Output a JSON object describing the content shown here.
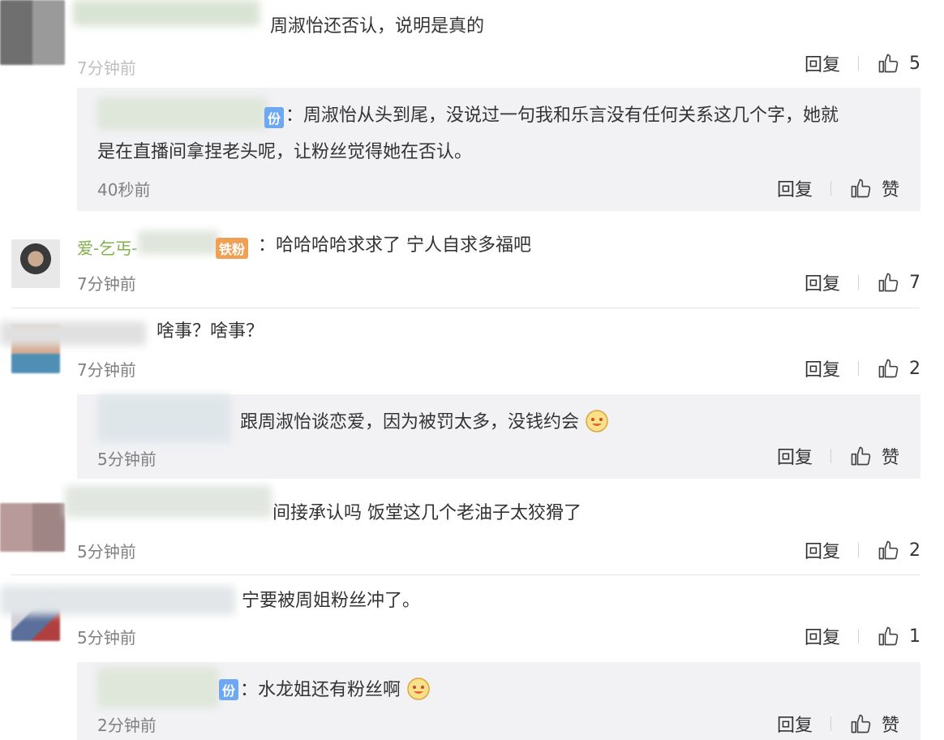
{
  "comments": [
    {
      "text": "周淑怡还否认，说明是真的",
      "time": "7分钟前",
      "reply": "回复",
      "likes": "5"
    },
    {
      "prefix": "：",
      "badge": "份",
      "text": "周淑怡从头到尾，没说过一句我和乐言没有任何关系这几个字，她就",
      "text2": "是在直播间拿捏老头呢，让粉丝觉得她在否认。",
      "time": "40秒前",
      "reply": "回复",
      "likes": "赞"
    },
    {
      "user": "爱-乞丐-",
      "badge": "铁粉",
      "prefix": "：",
      "text": "哈哈哈哈求求了 宁人自求多福吧",
      "time": "7分钟前",
      "reply": "回复",
      "likes": "7"
    },
    {
      "text": "啥事？啥事？",
      "time": "7分钟前",
      "reply": "回复",
      "likes": "2"
    },
    {
      "text": "跟周淑怡谈恋爱，因为被罚太多，没钱约会",
      "time": "5分钟前",
      "reply": "回复",
      "likes": "赞"
    },
    {
      "text": "间接承认吗 饭堂这几个老油子太狡猾了",
      "time": "5分钟前",
      "reply": "回复",
      "likes": "2"
    },
    {
      "text": "宁要被周姐粉丝冲了。",
      "time": "5分钟前",
      "reply": "回复",
      "likes": "1"
    },
    {
      "prefix": "：",
      "badge": "份",
      "text": "水龙姐还有粉丝啊",
      "time": "2分钟前",
      "reply": "回复",
      "likes": "赞"
    }
  ],
  "icons": {
    "like": "thumbs-up-icon",
    "emoji": "grinning-face-emoji"
  },
  "colors": {
    "reply_bg": "#f2f2f5",
    "text": "#333333",
    "time": "#808080",
    "divider": "#e2e2e2"
  }
}
